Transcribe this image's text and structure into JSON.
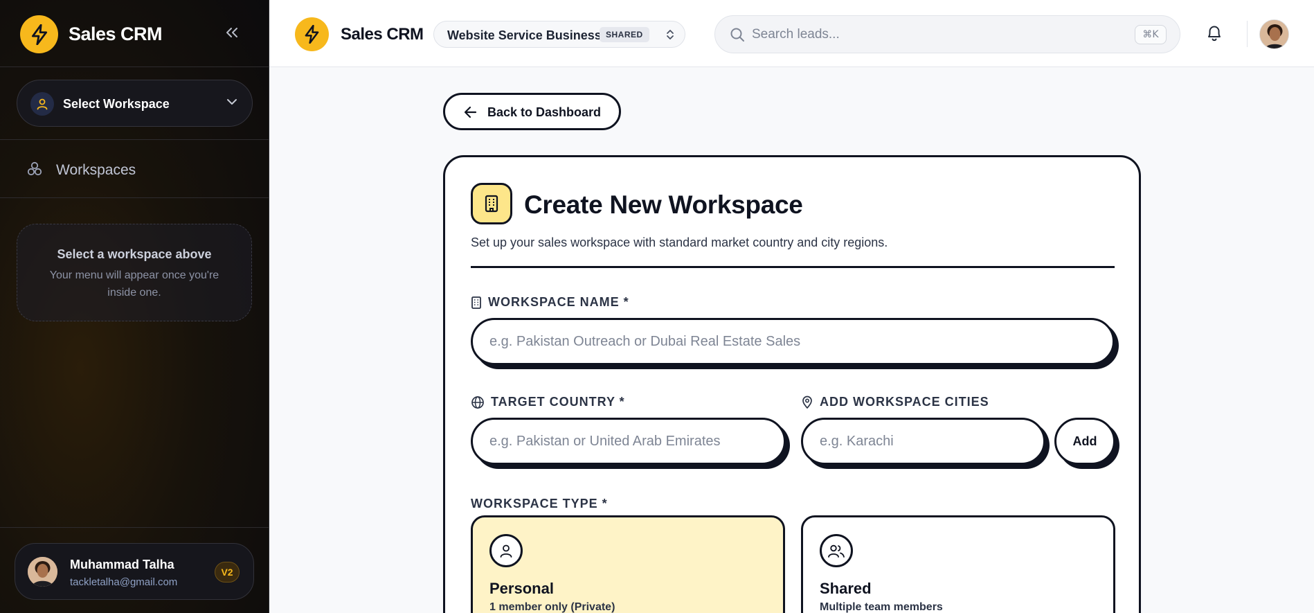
{
  "sidebar": {
    "brand": "Sales CRM",
    "workspace_select": "Select Workspace",
    "nav": {
      "workspaces": "Workspaces"
    },
    "empty": {
      "title": "Select a workspace above",
      "subtitle": "Your menu will appear once you're inside one."
    },
    "user": {
      "name": "Muhammad Talha",
      "email": "tackletalha@gmail.com",
      "badge": "V2"
    }
  },
  "topbar": {
    "brand": "Sales CRM",
    "workspace": {
      "name": "Website Service Business",
      "badge": "SHARED"
    },
    "search": {
      "placeholder": "Search leads...",
      "shortcut": "⌘K"
    }
  },
  "main": {
    "back_label": "Back to Dashboard",
    "title": "Create New Workspace",
    "subtitle": "Set up your sales workspace with standard market country and city regions.",
    "fields": {
      "name": {
        "label": "WORKSPACE NAME *",
        "placeholder": "e.g. Pakistan Outreach or Dubai Real Estate Sales"
      },
      "country": {
        "label": "TARGET COUNTRY *",
        "placeholder": "e.g. Pakistan or United Arab Emirates"
      },
      "cities": {
        "label": "ADD WORKSPACE CITIES",
        "placeholder": "e.g. Karachi",
        "add_label": "Add"
      }
    },
    "type": {
      "label": "WORKSPACE TYPE *",
      "options": [
        {
          "title": "Personal",
          "subtitle": "1 member only (Private)",
          "selected": true
        },
        {
          "title": "Shared",
          "subtitle": "Multiple team members",
          "selected": false
        }
      ]
    }
  },
  "colors": {
    "accent": "#f7b81c",
    "ink": "#0f1320",
    "selected_bg": "#fef3c7"
  }
}
